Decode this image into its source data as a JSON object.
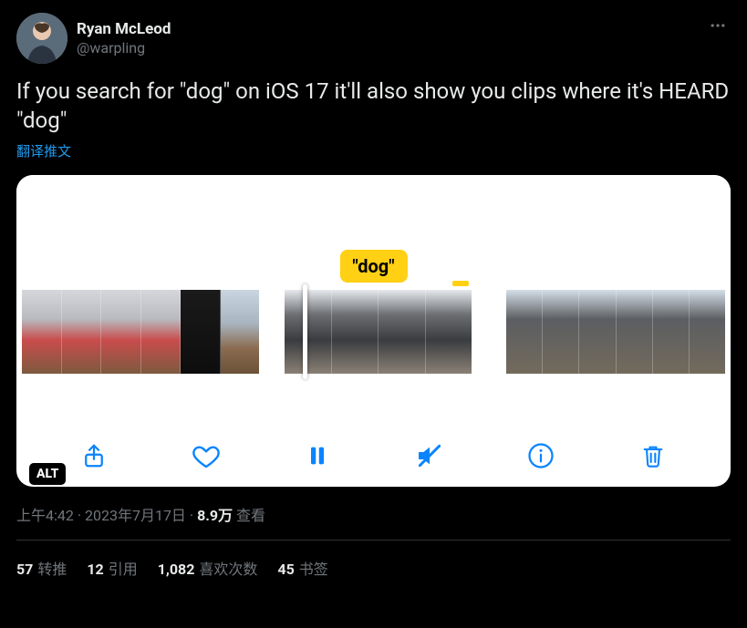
{
  "user": {
    "display_name": "Ryan McLeod",
    "handle": "@warpling"
  },
  "tweet_text": "If you search for \"dog\" on iOS 17 it'll also show you clips where it's HEARD \"dog\"",
  "translate_label": "翻译推文",
  "media": {
    "search_term_badge": "\"dog\"",
    "alt_badge": "ALT",
    "toolbar_icons": {
      "share": "share-icon",
      "heart": "heart-icon",
      "pause": "pause-icon",
      "mute": "mute-icon",
      "info": "info-icon",
      "trash": "trash-icon"
    }
  },
  "meta": {
    "time": "上午4:42",
    "separator": " · ",
    "date": "2023年7月17日",
    "views_count": "8.9万",
    "views_label": " 查看"
  },
  "stats": {
    "retweets_count": "57",
    "retweets_label": "转推",
    "quotes_count": "12",
    "quotes_label": "引用",
    "likes_count": "1,082",
    "likes_label": "喜欢次数",
    "bookmarks_count": "45",
    "bookmarks_label": "书签"
  }
}
